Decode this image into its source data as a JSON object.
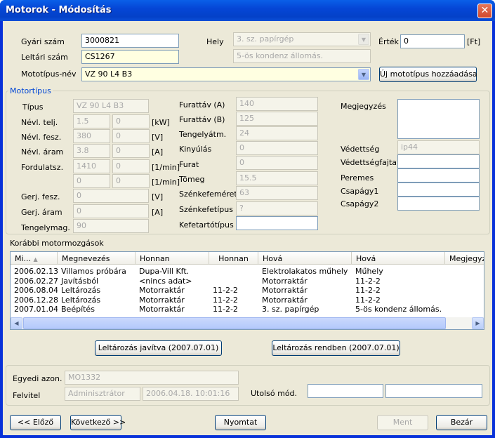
{
  "window": {
    "title": "Motorok - Módosítás",
    "close_glyph": "✕"
  },
  "top": {
    "gyari_szam": {
      "label": "Gyári szám",
      "value": "3000821"
    },
    "leltari_szam": {
      "label": "Leltári szám",
      "value": "CS1267"
    },
    "mototipus": {
      "label": "Mototípus-név",
      "value": "VZ 90 L4 B3"
    },
    "hely": {
      "label": "Hely",
      "value1": "3. sz. papírgép",
      "value2": "5-ös kondenz állomás."
    },
    "ertek": {
      "label": "Érték",
      "value": "0",
      "unit": "[Ft]"
    },
    "uj_button": "Új mototípus hozzáadása"
  },
  "motortipus": {
    "title": "Motortípus",
    "tipus": {
      "label": "Típus",
      "value": "VZ 90 L4 B3"
    },
    "nevl_telj": {
      "label": "Névl. telj.",
      "v1": "1.5",
      "v2": "0",
      "unit": "[kW]"
    },
    "nevl_fesz": {
      "label": "Névl. fesz.",
      "v1": "380",
      "v2": "0",
      "unit": "[V]"
    },
    "nevl_aram": {
      "label": "Névl. áram",
      "v1": "3.8",
      "v2": "0",
      "unit": "[A]"
    },
    "fordulatsz": {
      "label": "Fordulatsz.",
      "v1": "1410",
      "v2": "0",
      "unit": "[1/min]"
    },
    "fordulatsz2": {
      "v1": "0",
      "v2": "0",
      "unit": "[1/min]"
    },
    "gerj_fesz": {
      "label": "Gerj. fesz.",
      "value": "0",
      "unit": "[V]"
    },
    "gerj_aram": {
      "label": "Gerj. áram",
      "value": "0",
      "unit": "[A]"
    },
    "tengelymag": {
      "label": "Tengelymag.",
      "value": "90"
    },
    "furattav_a": {
      "label": "Furattáv (A)",
      "value": "140"
    },
    "furattav_b": {
      "label": "Furattáv (B)",
      "value": "125"
    },
    "tengelyatm": {
      "label": "Tengelyátm.",
      "value": "24"
    },
    "kinyulas": {
      "label": "Kinyúlás",
      "value": "0"
    },
    "furat": {
      "label": "Furat",
      "value": "0"
    },
    "tomeg": {
      "label": "Tömeg",
      "value": "15.5"
    },
    "szenkefemeret": {
      "label": "Szénkefeméret",
      "value": "63"
    },
    "szenkefetipus": {
      "label": "Szénkefetípus",
      "value": "?"
    },
    "kefetartotipus": {
      "label": "Kefetartótípus",
      "value": ""
    },
    "megjegyzes": {
      "label": "Megjegyzés",
      "value": ""
    },
    "vedettseg": {
      "label": "Védettség",
      "value": "ip44"
    },
    "vedettsegfajta": {
      "label": "Védettségfajta",
      "value": ""
    },
    "peremes": {
      "label": "Peremes",
      "value": ""
    },
    "csapagy1": {
      "label": "Csapágy1",
      "value": ""
    },
    "csapagy2": {
      "label": "Csapágy2",
      "value": ""
    }
  },
  "korabbi": {
    "title": "Korábbi motormozgások",
    "headers": [
      "Mi...",
      "Megnevezés",
      "Honnan",
      "Honnan",
      "Hová",
      "Hová",
      "Megjegyz"
    ],
    "rows": [
      [
        "2006.02.13",
        "Villamos próbára",
        "Dupa-Vill Kft.",
        "",
        "Elektrolakatos műhely",
        "Műhely",
        ""
      ],
      [
        "2006.02.27",
        "Javításból",
        "<nincs adat>",
        "",
        "Motorraktár",
        "11-2-2",
        ""
      ],
      [
        "2006.08.04",
        "Leltározás",
        "Motorraktár",
        "11-2-2",
        "Motorraktár",
        "11-2-2",
        ""
      ],
      [
        "2006.12.28",
        "Leltározás",
        "Motorraktár",
        "11-2-2",
        "Motorraktár",
        "11-2-2",
        ""
      ],
      [
        "2007.01.04",
        "Beépítés",
        "Motorraktár",
        "11-2-2",
        "3. sz. papírgép",
        "5-ös kondenz állomás.",
        ""
      ]
    ]
  },
  "leltar_buttons": {
    "javitva": "Leltározás javítva (2007.07.01)",
    "rendben": "Leltározás rendben (2007.07.01)"
  },
  "audit": {
    "egyedi_label": "Egyedi azon.",
    "egyedi_value": "MO1332",
    "felvitel_label": "Felvitel",
    "felvitel_user": "Adminisztrátor",
    "felvitel_time": "2006.04.18. 10:01:16",
    "utolso_label": "Utolsó mód.",
    "utolso_user": "",
    "utolso_time": ""
  },
  "footer": {
    "prev": "<< Előző",
    "next": "Következő >>",
    "print": "Nyomtat",
    "save": "Ment",
    "close": "Bezár"
  }
}
